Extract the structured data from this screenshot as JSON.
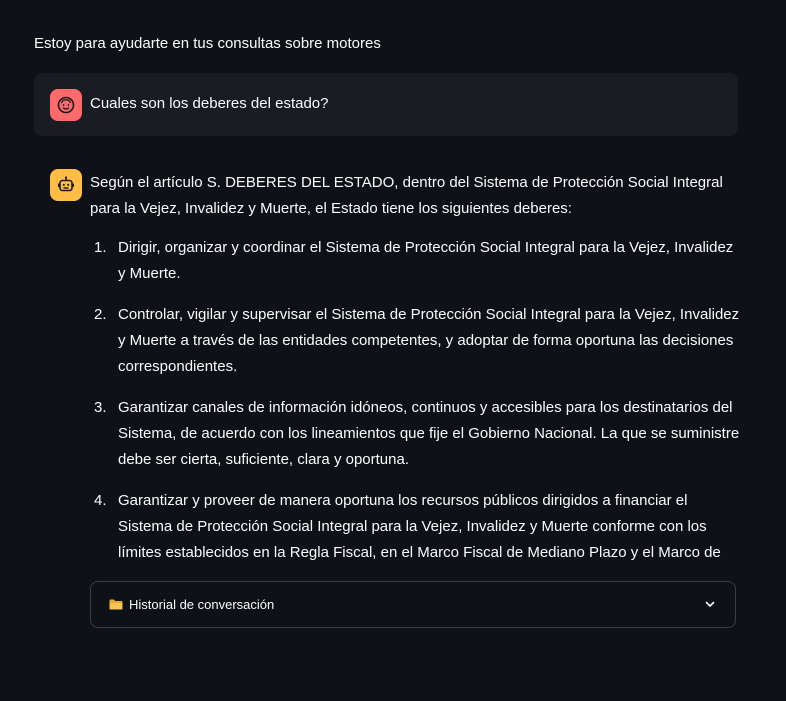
{
  "intro": {
    "text": "Estoy para ayudarte en tus consultas sobre motores"
  },
  "user_message": {
    "text": "Cuales son los deberes del estado?",
    "avatar_icon": "face-icon",
    "avatar_color": "#ff6b6b"
  },
  "bot_message": {
    "avatar_icon": "robot-icon",
    "avatar_color": "#ffbd45",
    "intro": "Según el artículo S. DEBERES DEL ESTADO, dentro del Sistema de Protección Social Integral para la Vejez, Invalidez y Muerte, el Estado tiene los siguientes deberes:",
    "duties": [
      {
        "num": "1.",
        "text": "Dirigir, organizar y coordinar el Sistema de Protección Social Integral para la Vejez, Invalidez y Muerte."
      },
      {
        "num": "2.",
        "text": "Controlar, vigilar y supervisar el Sistema de Protección Social Integral para la Vejez, Invalidez y Muerte a través de las entidades competentes, y adoptar de forma oportuna las decisiones correspondientes."
      },
      {
        "num": "3.",
        "text": "Garantizar canales de información idóneos, continuos y accesibles para los destinatarios del Sistema, de acuerdo con los lineamientos que fije el Gobierno Nacional. La que se suministre debe ser cierta, suficiente, clara y oportuna."
      },
      {
        "num": "4.",
        "text": "Garantizar y proveer de manera oportuna los recursos públicos dirigidos a financiar el Sistema de Protección Social Integral para la Vejez, Invalidez y Muerte conforme con los límites establecidos en la Regla Fiscal, en el Marco Fiscal de Mediano Plazo y el Marco de"
      }
    ]
  },
  "expander": {
    "label": "Historial de conversación",
    "icon": "folder-icon",
    "chevron": "chevron-down-icon"
  }
}
